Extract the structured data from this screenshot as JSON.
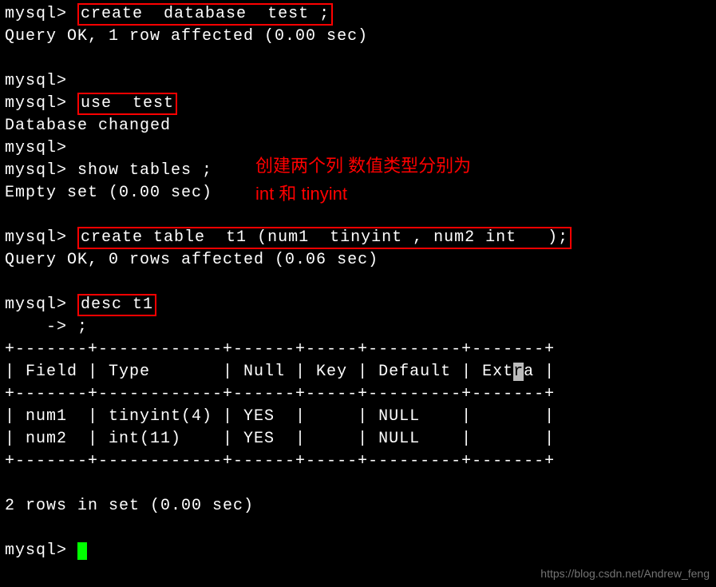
{
  "prompt": "mysql>",
  "continuation_prompt": "    ->",
  "commands": {
    "create_db": "create  database  test ;",
    "create_db_result": "Query OK, 1 row affected (0.00 sec)",
    "use_test": "use  test",
    "use_test_result": "Database changed",
    "show_tables": "show tables ;",
    "show_tables_result": "Empty set (0.00 sec)",
    "create_table": "create table  t1 (num1  tinyint , num2 int   );",
    "create_table_result": "Query OK, 0 rows affected (0.06 sec)",
    "desc": "desc t1",
    "desc_cont": ";"
  },
  "annotation": {
    "line1": "创建两个列  数值类型分别为",
    "line2": "int 和 tinyint"
  },
  "table": {
    "border": "+-------+------------+------+-----+---------+-------+",
    "headers": [
      "Field",
      "Type",
      "Null",
      "Key",
      "Default",
      "Extra"
    ],
    "header_row": "| Field | Type       | Null | Key | Default | Ext",
    "header_r_char": "r",
    "header_row_end": "a |",
    "rows": [
      {
        "field": "num1",
        "type": "tinyint(4)",
        "null": "YES",
        "key": "",
        "default": "NULL",
        "extra": ""
      },
      {
        "field": "num2",
        "type": "int(11)",
        "null": "YES",
        "key": "",
        "default": "NULL",
        "extra": ""
      }
    ],
    "row1_text": "| num1  | tinyint(4) | YES  |     | NULL    |       |",
    "row2_text": "| num2  | int(11)    | YES  |     | NULL    |       |",
    "summary": "2 rows in set (0.00 sec)"
  },
  "chart_data": {
    "type": "table",
    "title": "desc t1",
    "columns": [
      "Field",
      "Type",
      "Null",
      "Key",
      "Default",
      "Extra"
    ],
    "rows": [
      [
        "num1",
        "tinyint(4)",
        "YES",
        "",
        "NULL",
        ""
      ],
      [
        "num2",
        "int(11)",
        "YES",
        "",
        "NULL",
        ""
      ]
    ]
  },
  "watermark": "https://blog.csdn.net/Andrew_feng"
}
